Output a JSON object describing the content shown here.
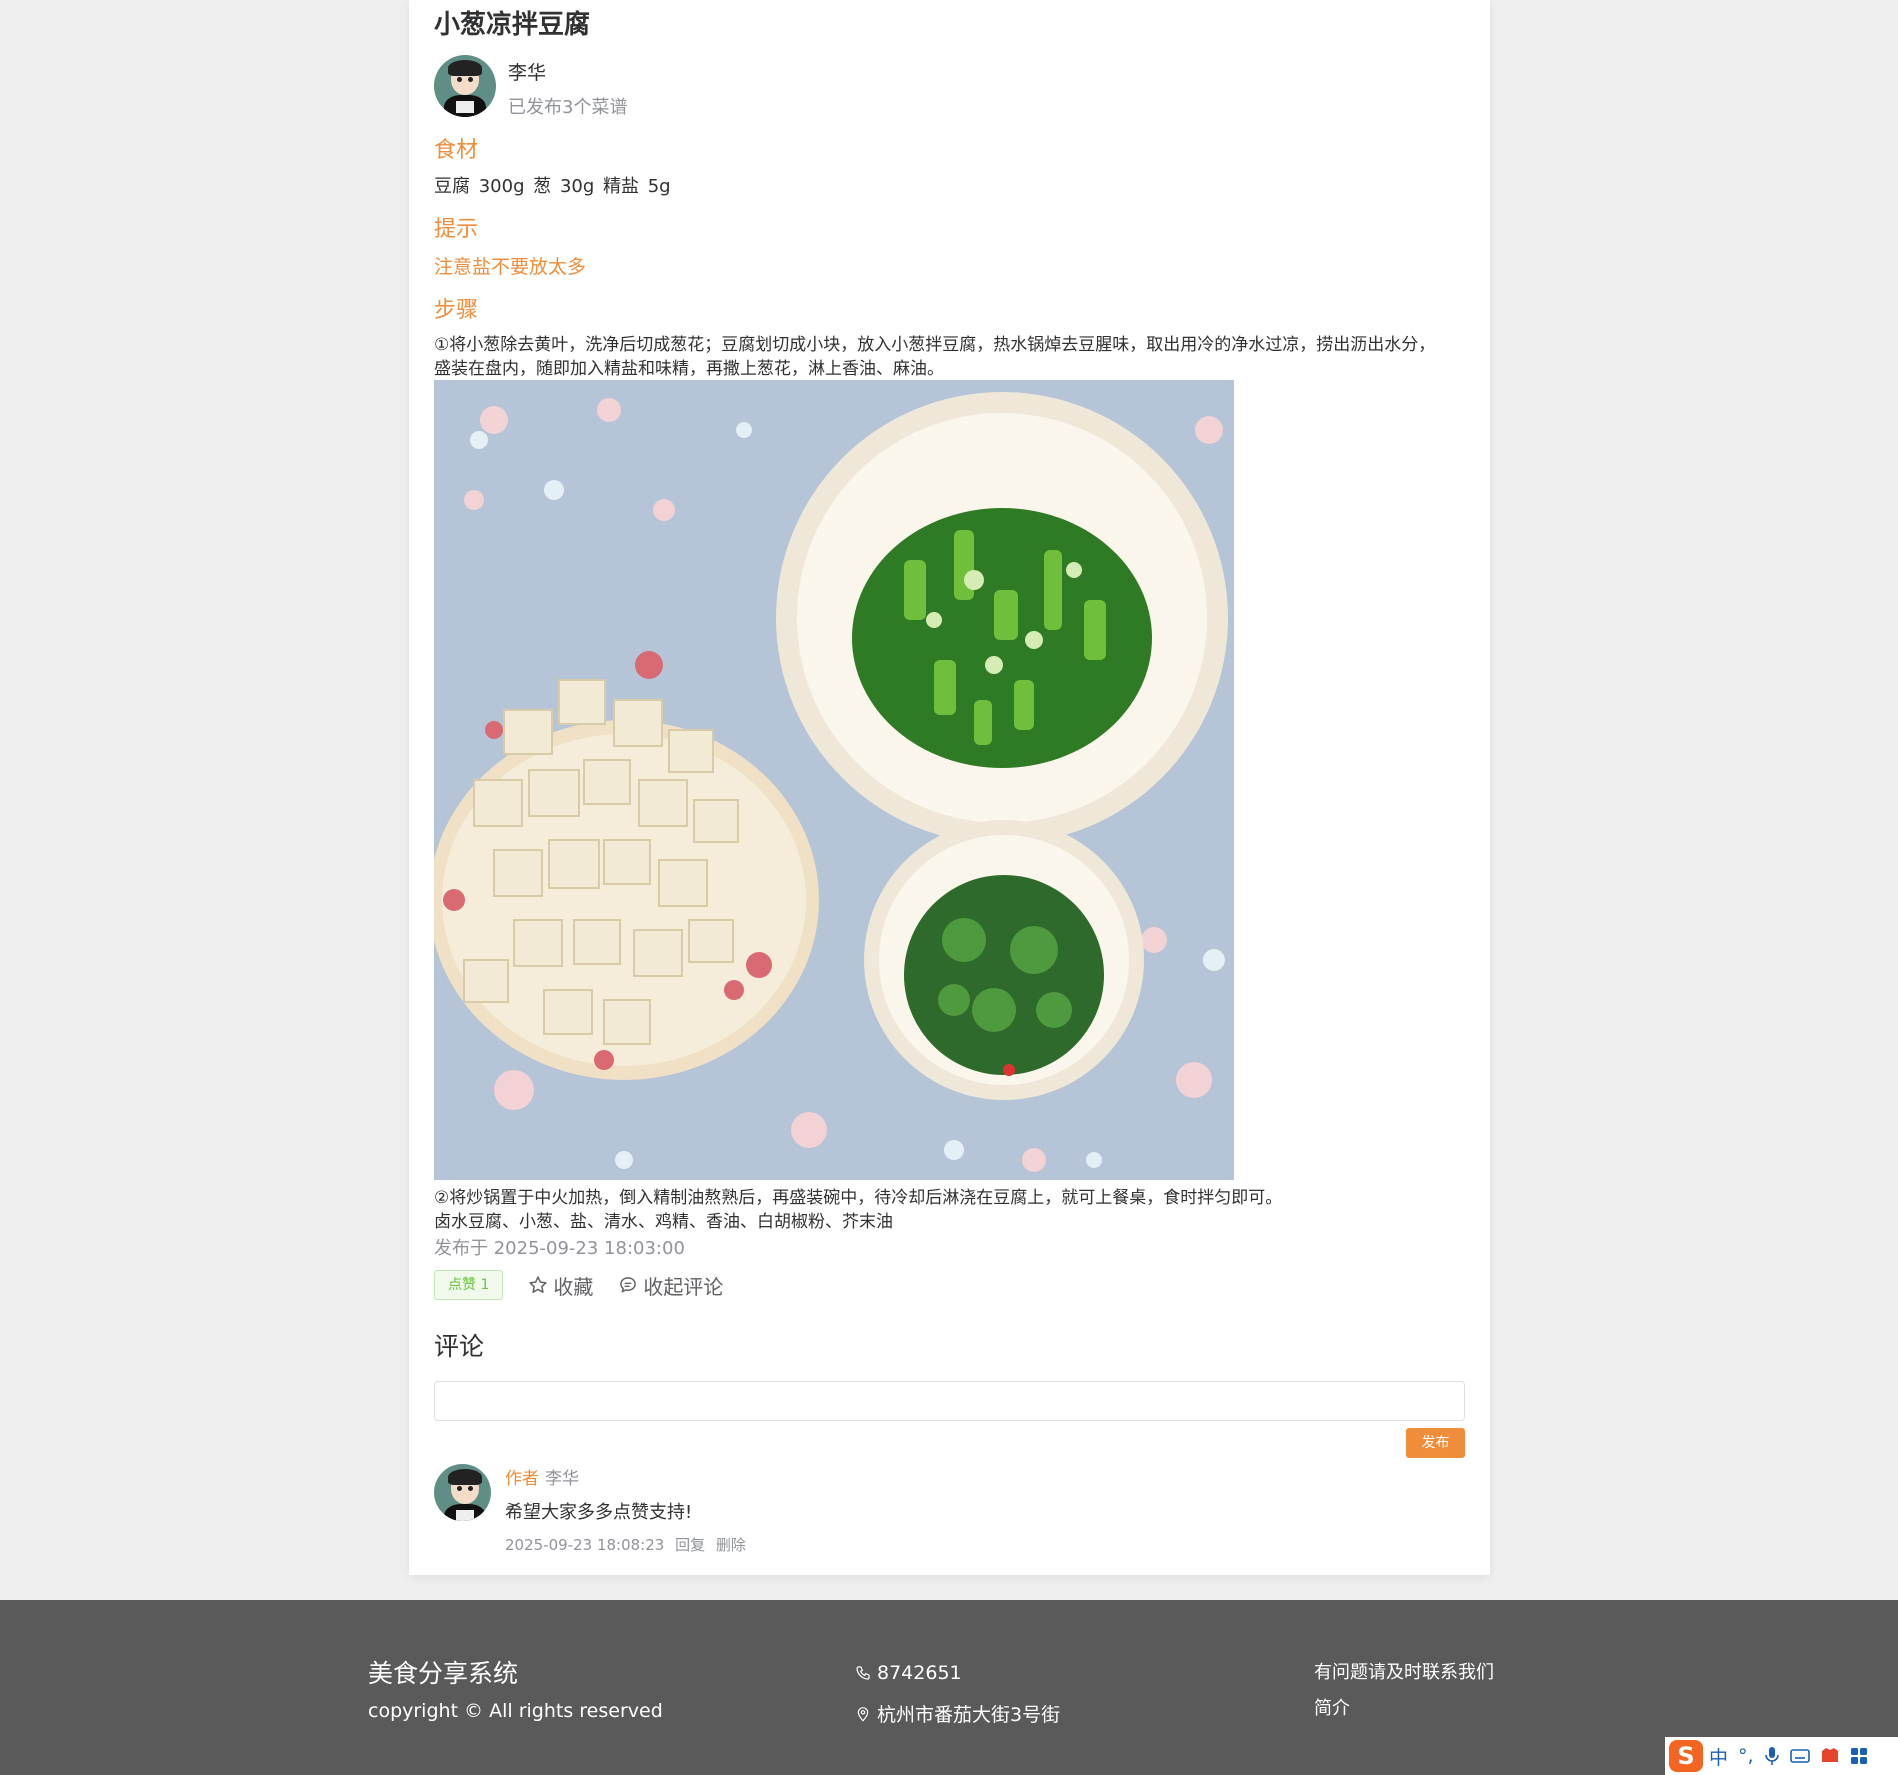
{
  "recipe": {
    "title": "小葱凉拌豆腐",
    "author_name": "李华",
    "author_sub": "已发布3个菜谱",
    "ingredients_heading": "食材",
    "ingredients": "豆腐 300g  葱 30g  精盐 5g",
    "tips_heading": "提示",
    "tip": "注意盐不要放太多",
    "steps_heading": "步骤",
    "step1": "①将小葱除去黄叶，洗净后切成葱花；豆腐划切成小块，放入小葱拌豆腐，热水锅焯去豆腥味，取出用冷的净水过凉，捞出沥出水分，盛装在盘内，随即加入精盐和味精，再撒上葱花，淋上香油、麻油。",
    "step2": "②将炒锅置于中火加热，倒入精制油熬熟后，再盛装碗中，待冷却后淋浇在豆腐上，就可上餐桌，食时拌匀即可。",
    "step3": "卤水豆腐、小葱、盐、清水、鸡精、香油、白胡椒粉、芥末油",
    "published": "发布于 2025-09-23 18:03:00"
  },
  "actions": {
    "like_label": "点赞 1",
    "favorite_label": "收藏",
    "collapse_comments_label": "收起评论"
  },
  "comments": {
    "heading": "评论",
    "input_value": "",
    "publish_label": "发布",
    "items": [
      {
        "author_tag": "作者",
        "author_name": "李华",
        "text": "希望大家多多点赞支持!",
        "time": "2025-09-23 18:08:23",
        "reply_label": "回复",
        "delete_label": "删除"
      }
    ]
  },
  "footer": {
    "brand": "美食分享系统",
    "copyright": "copyright © All rights reserved",
    "phone": "8742651",
    "address": "杭州市番茄大街3号街",
    "contact_note": "有问题请及时联系我们",
    "intro_label": "简介"
  },
  "ime": {
    "logo": "S",
    "mode": "中",
    "punct": "°,"
  },
  "colors": {
    "accent": "#ef8d3a",
    "footer_bg": "#5a5a5a",
    "like_green": "#67c23a"
  }
}
